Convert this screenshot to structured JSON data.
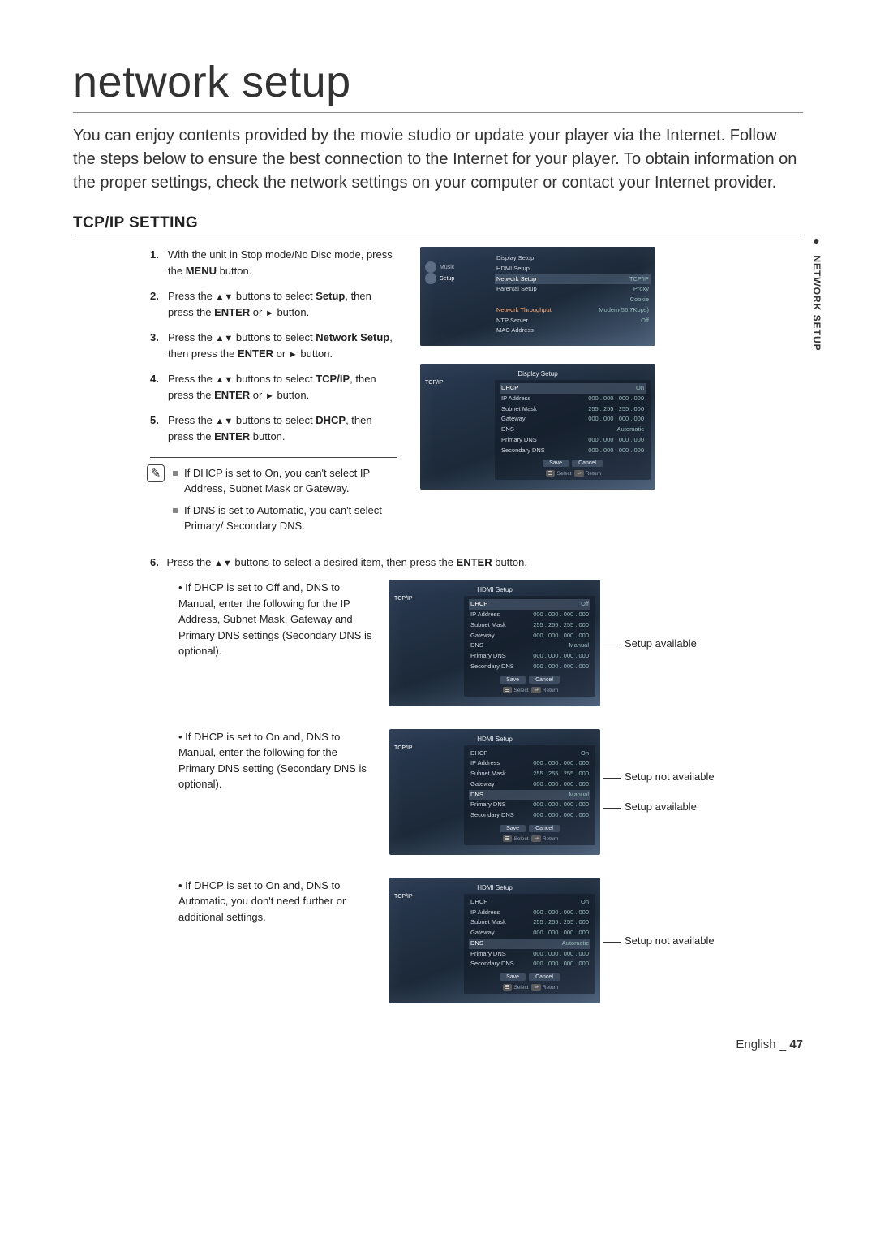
{
  "title": "network setup",
  "intro": "You can enjoy contents provided by the movie studio or update your player via the Internet. Follow the steps below to ensure the best connection to the Internet for your player. To obtain information on the proper settings, check the network settings on your computer or contact your Internet provider.",
  "side_tab": "NETWORK SETUP",
  "section_heading": "TCP/IP SETTING",
  "steps": {
    "s1_a": "With the unit in Stop mode/No Disc mode, press the ",
    "s1_b": "MENU",
    "s1_c": " button.",
    "s2_a": "Press the ",
    "s2_arrows": "▲▼",
    "s2_b": " buttons to select ",
    "s2_setup": "Setup",
    "s2_c": ", then press the ",
    "s2_enter": "ENTER",
    "s2_d": " or ",
    "s2_play": "►",
    "s2_e": " button.",
    "s3_a": "Press the ",
    "s3_b": " buttons to select ",
    "s3_net": "Network Setup",
    "s3_c": ", then press the ",
    "s3_enter": "ENTER",
    "s3_d": " or ",
    "s3_play": "►",
    "s3_e": " button.",
    "s4_a": "Press the ",
    "s4_b": " buttons to select ",
    "s4_tcp": "TCP/IP",
    "s4_c": ", then press the ",
    "s4_enter": "ENTER",
    "s4_d": " or ",
    "s4_play": "►",
    "s4_e": " button.",
    "s5_a": "Press the ",
    "s5_b": " buttons to select ",
    "s5_dhcp": "DHCP",
    "s5_c": ", then press the ",
    "s5_enter": "ENTER",
    "s5_d": " button."
  },
  "notes": {
    "n1": "If DHCP is set to On, you can't select IP Address, Subnet Mask or Gateway.",
    "n2": "If DNS is set to Automatic, you can't select Primary/ Secondary DNS."
  },
  "step6": {
    "num": "6.",
    "a": "Press the ",
    "arrows": "▲▼",
    "b": " buttons to select a desired item, then press the ",
    "enter": "ENTER",
    "c": " button."
  },
  "scenarios": {
    "sc1": "If DHCP is set to Off and, DNS to Manual, enter the following for the IP Address, Subnet Mask, Gateway and Primary DNS settings (Secondary DNS is optional).",
    "sc2": "If DHCP is set to On and, DNS to Manual, enter the following for the Primary DNS setting (Secondary DNS is optional).",
    "sc3": "If DHCP is set to On and, DNS to Automatic, you don't need further or additional settings."
  },
  "callouts": {
    "avail": "Setup available",
    "notavail": "Setup not available"
  },
  "screens": {
    "menu": {
      "music": "Music",
      "setup": "Setup",
      "display": "Display Setup",
      "hdmi": "HDMI Setup",
      "network": "Network Setup",
      "parental": "Parental Setup",
      "tcpip": "TCP/IP",
      "proxy": "Proxy",
      "cookie": "Cookie",
      "thru": "Network Throughput",
      "thru_v": "Modem(56.7Kbps)",
      "ntp": "NTP Server",
      "ntp_v": "Off",
      "mac": "MAC Address"
    },
    "tcpip": {
      "title": "TCP/IP",
      "dhcp": "DHCP",
      "on": "On",
      "off": "Off",
      "ip": "IP Address",
      "ip_v": "000 . 000 . 000 . 000",
      "subnet": "Subnet Mask",
      "subnet_v": "255 . 255 . 255 . 000",
      "gw": "Gateway",
      "gw_v": "000 . 000 . 000 . 000",
      "dns": "DNS",
      "dns_auto": "Automatic",
      "dns_manual": "Manual",
      "pdns": "Primary DNS",
      "pdns_v": "000 . 000 . 000 . 000",
      "sdns": "Secondary DNS",
      "sdns_v": "000 . 000 . 000 . 000",
      "save": "Save",
      "cancel": "Cancel",
      "select": "Select",
      "return": "Return"
    }
  },
  "footer": {
    "lang": "English",
    "sep": "_",
    "page": "47"
  }
}
